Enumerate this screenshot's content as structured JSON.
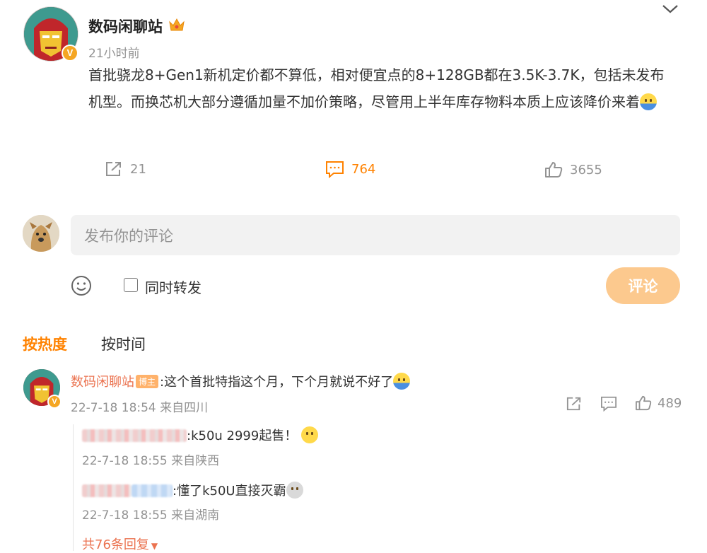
{
  "post": {
    "author": "数码闲聊站",
    "time": "21小时前",
    "content": "首批骁龙8+Gen1新机定价都不算低，相对便宜点的8+128GB都在3.5K-3.7K，包括未发布机型。而换芯机大部分遵循加量不加价策略，尽管用上半年库存物料本质上应该降价来着",
    "repost_count": "21",
    "comment_count": "764",
    "like_count": "3655",
    "icons": [
      "crown-icon",
      "chevron-down-icon",
      "repost-icon",
      "comment-icon",
      "like-icon"
    ]
  },
  "composer": {
    "placeholder": "发布你的评论",
    "repost_label": "同时转发",
    "submit_label": "评论"
  },
  "sort": {
    "hot": "按热度",
    "time": "按时间"
  },
  "comment": {
    "author": "数码闲聊站",
    "badge": "博主",
    "text": ":这个首批特指这个月，下个月就说不好了",
    "meta": "22-7-18 18:54 来自四川",
    "like_count": "489",
    "replies": [
      {
        "text": ":k50u 2999起售！",
        "meta": "22-7-18 18:55 来自陕西"
      },
      {
        "text": ":懂了k50U直接灭霸",
        "meta": "22-7-18 18:55 来自湖南"
      }
    ],
    "more_replies": "共76条回复"
  },
  "colors": {
    "accent": "#ff8200",
    "name_link": "#eb7350",
    "submit_bg": "#fcc98e",
    "vip_badge": "#f5a623"
  }
}
